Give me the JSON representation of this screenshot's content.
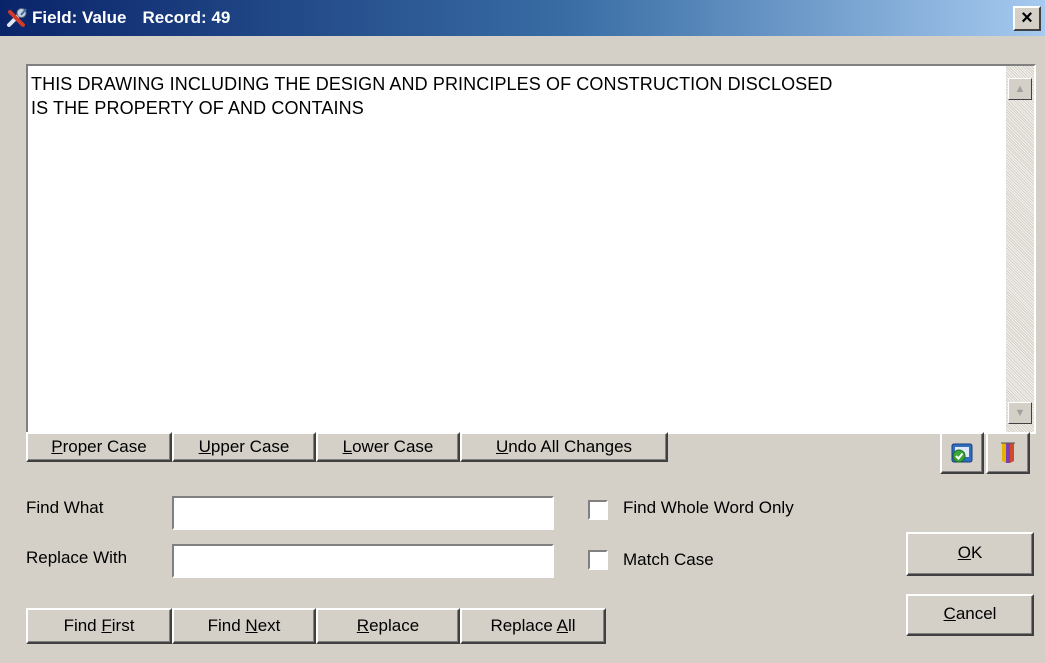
{
  "window": {
    "title_field": "Field: Value",
    "title_record": "Record: 49",
    "close_glyph": "×"
  },
  "editor": {
    "value": "THIS DRAWING INCLUDING THE DESIGN AND PRINCIPLES OF CONSTRUCTION DISCLOSED\nIS THE PROPERTY OF AND CONTAINS",
    "scroll_up_glyph": "▲",
    "scroll_down_glyph": "▼"
  },
  "case_toolbar": {
    "proper_case": {
      "pre": "",
      "key": "P",
      "post": "roper Case"
    },
    "upper_case": {
      "pre": "",
      "key": "U",
      "post": "pper Case"
    },
    "lower_case": {
      "pre": "",
      "key": "L",
      "post": "ower Case"
    },
    "undo_all": {
      "pre": "",
      "key": "U",
      "post": "ndo All Changes"
    }
  },
  "icons": {
    "left": "spellcheck-icon",
    "right": "highlighter-icon"
  },
  "find": {
    "find_what_label": "Find What",
    "find_what_value": "",
    "replace_with_label": "Replace With",
    "replace_with_value": "",
    "whole_word_label": "Find Whole Word Only",
    "whole_word_checked": false,
    "match_case_label": "Match Case",
    "match_case_checked": false
  },
  "find_buttons": {
    "find_first": {
      "pre": "Find ",
      "key": "F",
      "post": "irst"
    },
    "find_next": {
      "pre": "Find ",
      "key": "N",
      "post": "ext"
    },
    "replace": {
      "pre": "",
      "key": "R",
      "post": "eplace"
    },
    "replace_all": {
      "pre": "Replace ",
      "key": "A",
      "post": "ll"
    }
  },
  "dialog_buttons": {
    "ok": {
      "pre": "",
      "key": "O",
      "post": "K"
    },
    "cancel": {
      "pre": "",
      "key": "C",
      "post": "ancel"
    }
  },
  "colors": {
    "title_gradient_start": "#0a246a",
    "title_gradient_end": "#a6caf0",
    "face": "#d4d0c8"
  }
}
